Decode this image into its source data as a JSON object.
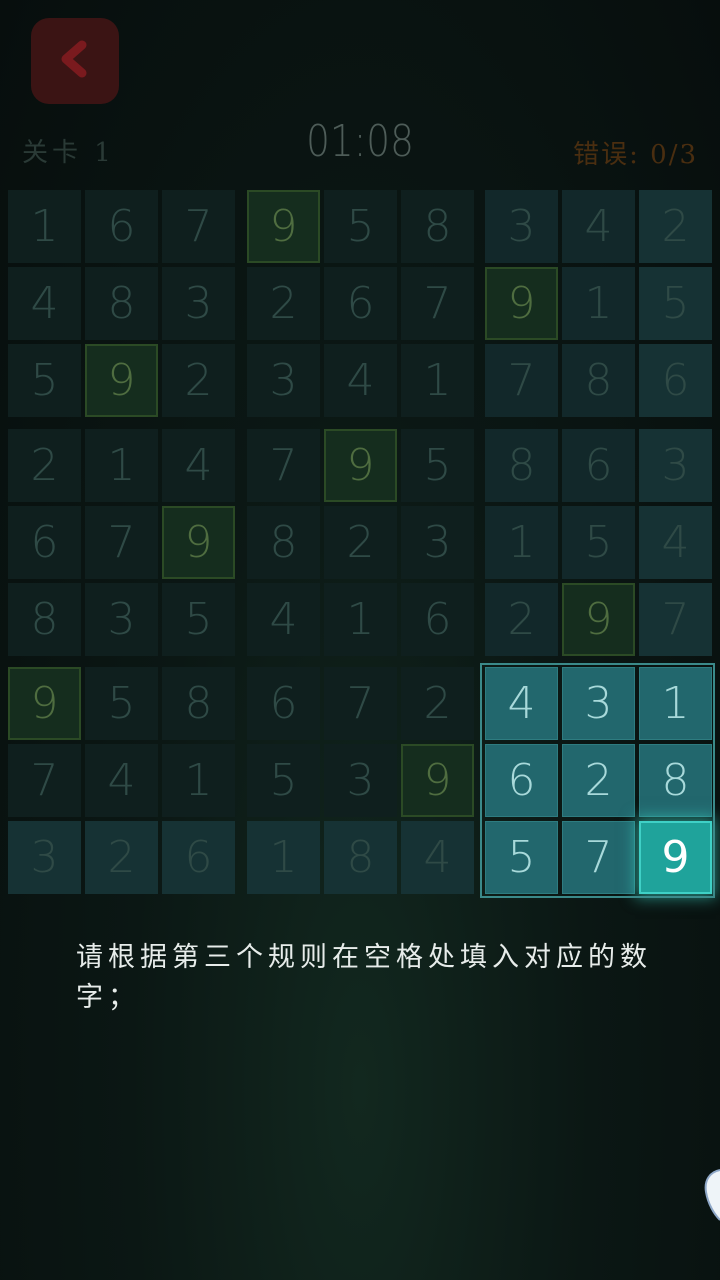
{
  "header": {
    "back_icon": "chevron-left-icon",
    "level": "关卡 1",
    "timer": "01:08",
    "mistakes": "错误: 0/3"
  },
  "board": {
    "rows": [
      [
        "1",
        "6",
        "7",
        "9",
        "5",
        "8",
        "3",
        "4",
        "2"
      ],
      [
        "4",
        "8",
        "3",
        "2",
        "6",
        "7",
        "9",
        "1",
        "5"
      ],
      [
        "5",
        "9",
        "2",
        "3",
        "4",
        "1",
        "7",
        "8",
        "6"
      ],
      [
        "2",
        "1",
        "4",
        "7",
        "9",
        "5",
        "8",
        "6",
        "3"
      ],
      [
        "6",
        "7",
        "9",
        "8",
        "2",
        "3",
        "1",
        "5",
        "4"
      ],
      [
        "8",
        "3",
        "5",
        "4",
        "1",
        "6",
        "2",
        "9",
        "7"
      ],
      [
        "9",
        "5",
        "8",
        "6",
        "7",
        "2",
        "4",
        "3",
        "1"
      ],
      [
        "7",
        "4",
        "1",
        "5",
        "3",
        "9",
        "6",
        "2",
        "8"
      ],
      [
        "3",
        "2",
        "6",
        "1",
        "8",
        "4",
        "5",
        "7",
        "9"
      ]
    ],
    "highlighted_digit": "9",
    "selected_box": "bottom-right",
    "active_cell_value": "9"
  },
  "instruction": "请根据第三个规则在空格处填入对应的数字；",
  "colors": {
    "accent": "#1fa39b",
    "back_button": "#3b1414",
    "mistakes_text": "#4a2e10"
  }
}
